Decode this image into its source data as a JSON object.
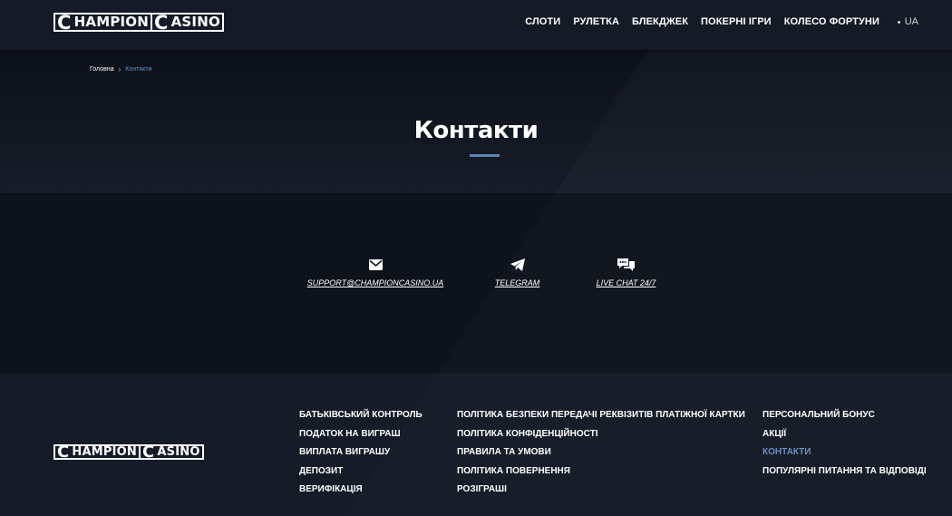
{
  "brand": {
    "logo_cap1": "C",
    "logo_rest1": "HAMPION",
    "logo_cap2": "C",
    "logo_rest2": "ASINO"
  },
  "header": {
    "nav": [
      "СЛОТИ",
      "РУЛЕТКА",
      "БЛЕКДЖЕК",
      "ПОКЕРНІ ІГРИ",
      "КОЛЕСО ФОРТУНИ"
    ],
    "language": "UA"
  },
  "breadcrumb": {
    "home": "Головна",
    "separator": "›",
    "current": "Контакти"
  },
  "page": {
    "title": "Контакти"
  },
  "contacts": [
    {
      "icon": "envelope-icon",
      "label": "SUPPORT@CHAMPIONCASINO.UA"
    },
    {
      "icon": "telegram-icon",
      "label": "TELEGRAM"
    },
    {
      "icon": "chat-icon",
      "label": "LIVE CHAT 24/7"
    }
  ],
  "footer": {
    "col1": [
      "БАТЬКІВСЬКИЙ КОНТРОЛЬ",
      "ПОДАТОК НА ВИГРАШ",
      "ВИПЛАТА ВИГРАШУ",
      "ДЕПОЗИТ",
      "ВЕРИФІКАЦІЯ"
    ],
    "col2": [
      "ПОЛІТИКА БЕЗПЕКИ ПЕРЕДАЧІ РЕКВІЗИТІВ ПЛАТІЖНОЇ КАРТКИ",
      "ПОЛІТИКА КОНФІДЕНЦІЙНОСТІ",
      "ПРАВИЛА ТА УМОВИ",
      "ПОЛІТИКА ПОВЕРНЕННЯ",
      "РОЗІГРАШІ"
    ],
    "col3": [
      "ПЕРСОНАЛЬНИЙ БОНУС",
      "АКЦІЇ",
      "КОНТАКТИ",
      "ПОПУЛЯРНІ ПИТАННЯ ТА ВІДПОВІДІ"
    ],
    "active_item": "КОНТАКТИ"
  },
  "colors": {
    "accent": "#5f83b3",
    "link_active": "#6a8fc0",
    "header_bg": "#141a26",
    "page_bg": "#0e131d"
  }
}
